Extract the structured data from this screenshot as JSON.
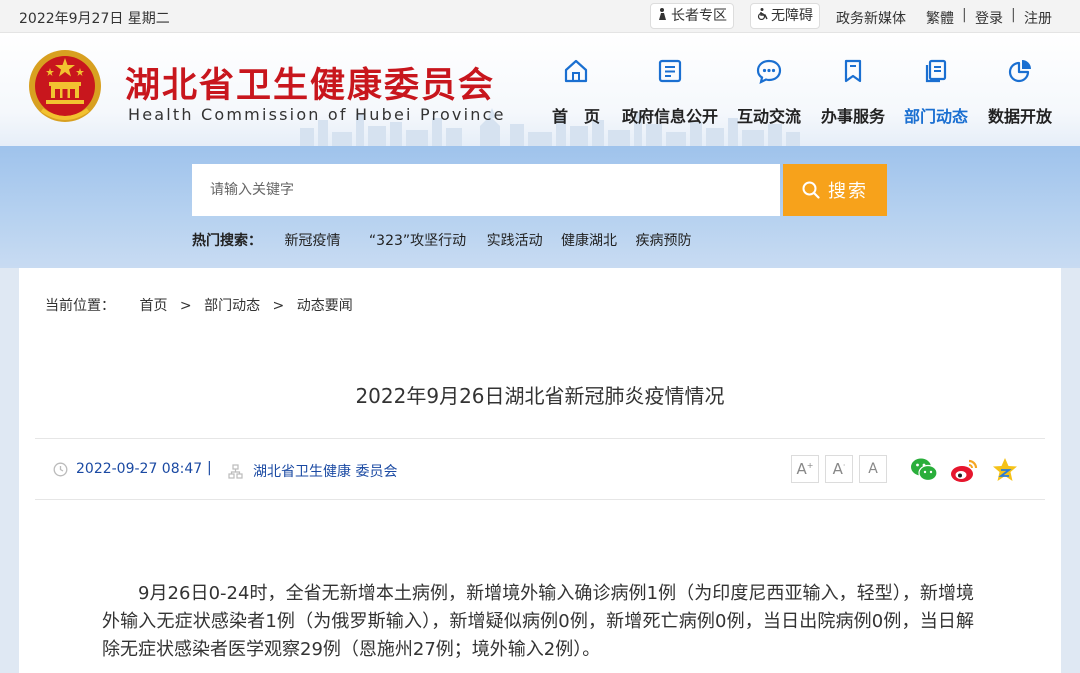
{
  "topbar": {
    "date": "2022年9月27日 星期二",
    "elder_label": "长者专区",
    "access_label": "无障碍",
    "media_label": "政务新媒体",
    "trad_label": "繁體",
    "sep": "|",
    "login_label": "登录",
    "register_label": "注册"
  },
  "header": {
    "title_cn": "湖北省卫生健康委员会",
    "title_en": "Health Commission of Hubei Province",
    "nav": [
      {
        "label": "首　页",
        "icon": "home-icon"
      },
      {
        "label": "政府信息公开",
        "icon": "document-icon"
      },
      {
        "label": "互动交流",
        "icon": "chat-icon"
      },
      {
        "label": "办事服务",
        "icon": "bookmark-icon"
      },
      {
        "label": "部门动态",
        "icon": "pages-icon",
        "active": true
      },
      {
        "label": "数据开放",
        "icon": "pie-chart-icon"
      }
    ]
  },
  "search": {
    "placeholder": "请输入关键字",
    "button_label": "搜索",
    "hot_label": "热门搜索：",
    "hot_keywords": [
      "新冠疫情",
      "“323”攻坚行动",
      "实践活动",
      "健康湖北",
      "疾病预防"
    ]
  },
  "breadcrumb": {
    "label": "当前位置：",
    "items": [
      "首页",
      "部门动态",
      "动态要闻"
    ],
    "sep": ">"
  },
  "article": {
    "title": "2022年9月26日湖北省新冠肺炎疫情情况",
    "datetime": "2022-09-27 08:47",
    "sep": "|",
    "source": "湖北省卫生健康 委员会",
    "font_buttons": [
      "A+",
      "A",
      "A-"
    ],
    "share_icons": [
      "wechat-icon",
      "weibo-icon",
      "favorite-icon"
    ],
    "body": "9月26日0-24时，全省无新增本土病例，新增境外输入确诊病例1例（为印度尼西亚输入，轻型），新增境外输入无症状感染者1例（为俄罗斯输入），新增疑似病例0例，新增死亡病例0例，当日出院病例0例，当日解除无症状感染者医学观察29例（恩施州27例；境外输入2例）。"
  },
  "colors": {
    "brand_red": "#c8161d",
    "active_blue": "#1a6fd1",
    "search_orange": "#f7a21b",
    "meta_blue": "#1b4aa3"
  }
}
